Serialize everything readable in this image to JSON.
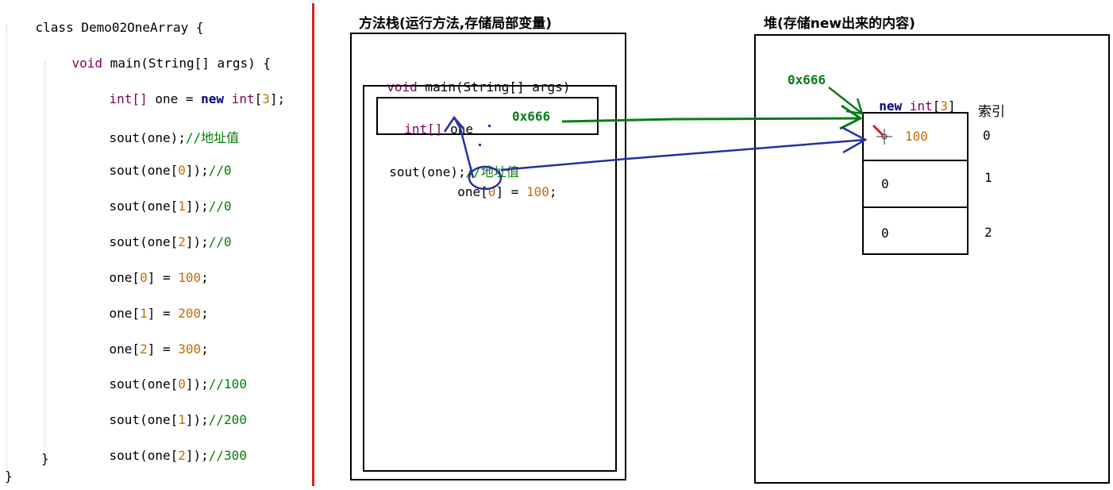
{
  "code": {
    "class_kw": "class",
    "class_name": "Demo02OneArray {",
    "method_void": "void",
    "method_sig": " main(String[] args) {",
    "l1_type": "int[]",
    "l1_mid": " one = ",
    "l1_new": "new",
    "l1_int": " int",
    "l1_br_open": "[",
    "l1_num": "3",
    "l1_br_close": "];",
    "l2_code": "sout(one);",
    "l2_cmt": "//",
    "l2_cn": "地址值",
    "l3_pre": "sout(one[",
    "l3_num": "0",
    "l3_post": "]);",
    "l3_cmt": "//0",
    "l4_pre": "sout(one[",
    "l4_num": "1",
    "l4_post": "]);",
    "l4_cmt": "//0",
    "l5_pre": "sout(one[",
    "l5_num": "2",
    "l5_post": "]);",
    "l5_cmt": "//0",
    "l6_pre": "one[",
    "l6_idx": "0",
    "l6_mid": "] = ",
    "l6_val": "100",
    "l6_end": ";",
    "l7_pre": "one[",
    "l7_idx": "1",
    "l7_mid": "] = ",
    "l7_val": "200",
    "l7_end": ";",
    "l8_pre": "one[",
    "l8_idx": "2",
    "l8_mid": "] = ",
    "l8_val": "300",
    "l8_end": ";",
    "l9_pre": "sout(one[",
    "l9_num": "0",
    "l9_post": "]);",
    "l9_cmt": "//100",
    "l10_pre": "sout(one[",
    "l10_num": "1",
    "l10_post": "]);",
    "l10_cmt": "//200",
    "l11_pre": "sout(one[",
    "l11_num": "2",
    "l11_post": "]);",
    "l11_cmt": "//300",
    "close_method": "}",
    "close_class": "}"
  },
  "stack": {
    "title": "方法栈(运行方法,存储局部变量)",
    "frame_void": "void",
    "frame_sig": " main(String[] args)",
    "var_type": "int[]",
    "var_name": " one",
    "var_value": "0x666",
    "line1_code": "sout(one);",
    "line1_cmt": "//",
    "line1_cn": "地址值",
    "line2_pre": "one[",
    "line2_idx": "0",
    "line2_mid": "] = ",
    "line2_val": "100",
    "line2_end": ";"
  },
  "heap": {
    "title": "堆(存储new出来的内容)",
    "address": "0x666",
    "new_kw": "new",
    "new_int": " int",
    "new_br_open": "[",
    "new_num": "3",
    "new_br_close": "]",
    "index_label": "索引",
    "cells": [
      {
        "value": "100",
        "index": "0"
      },
      {
        "value": "0",
        "index": "1"
      },
      {
        "value": "0",
        "index": "2"
      }
    ]
  },
  "colors": {
    "divider": "#d42020",
    "arrow_green": "#0a7a1a",
    "arrow_blue": "#2630a0",
    "number": "#c46e00",
    "keyword": "#7f0055",
    "comment": "#008000"
  }
}
